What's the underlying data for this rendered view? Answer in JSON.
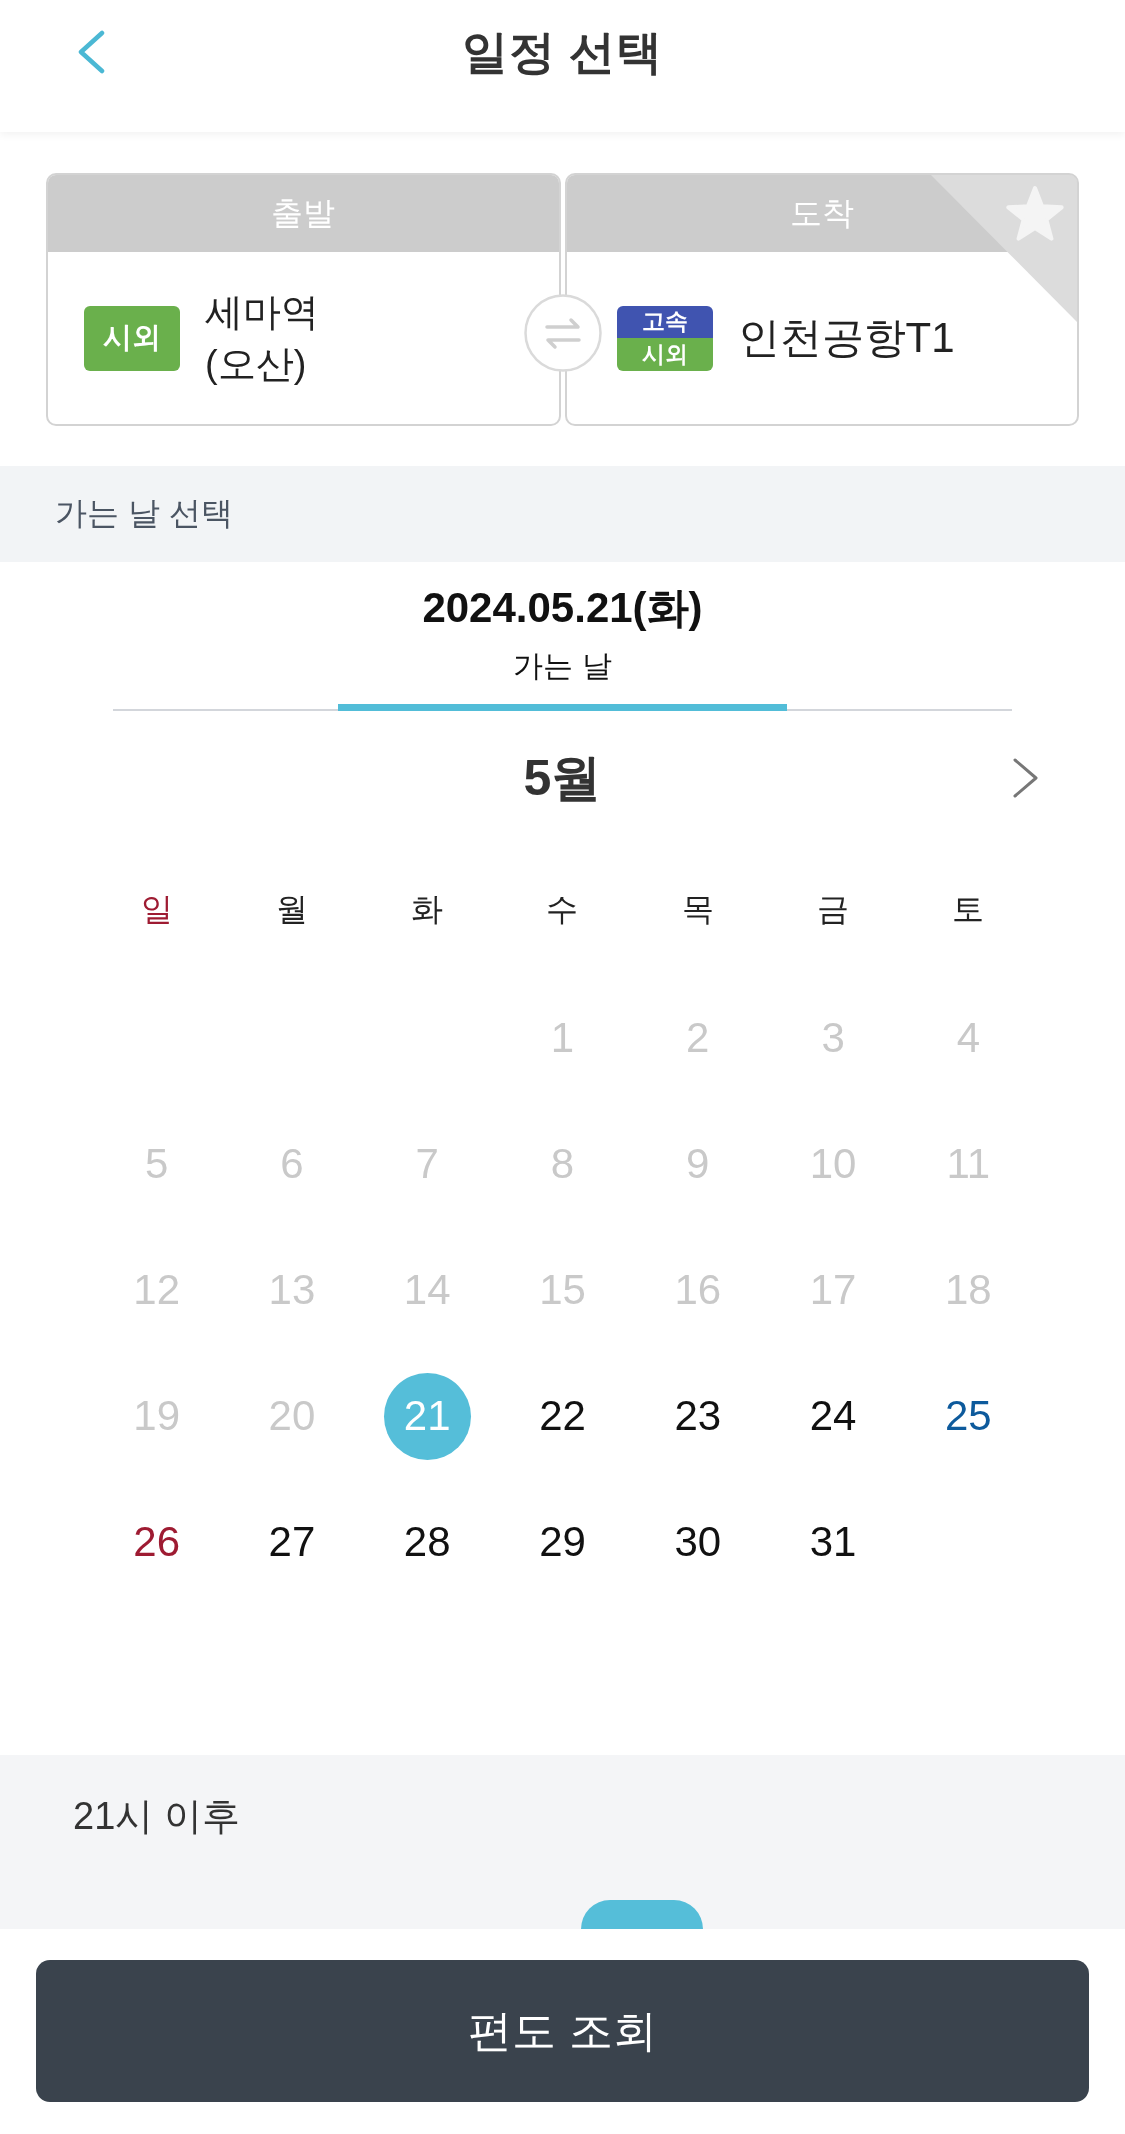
{
  "header": {
    "title": "일정 선택"
  },
  "route": {
    "departure": {
      "label": "출발",
      "badges": [
        {
          "label": "시외",
          "kind": "intercity"
        }
      ],
      "name": "세마역 (오산)"
    },
    "arrival": {
      "label": "도착",
      "badges": [
        {
          "label": "고속",
          "kind": "express"
        },
        {
          "label": "시외",
          "kind": "intercity"
        }
      ],
      "name": "인천공항T1",
      "favorite": false
    }
  },
  "section_title": "가는 날 선택",
  "tabs": [
    {
      "date": "2024.05.21(화)",
      "label": "가는 날",
      "selected": true
    }
  ],
  "calendar": {
    "month": "5월",
    "weekdays": [
      "일",
      "월",
      "화",
      "수",
      "목",
      "금",
      "토"
    ],
    "weeks": [
      [
        {
          "day": "1",
          "disabled": true,
          "selected": false
        },
        {
          "day": "2",
          "disabled": true,
          "selected": false
        },
        {
          "day": "3",
          "disabled": true,
          "selected": false
        },
        {
          "day": "4",
          "disabled": true,
          "selected": false
        }
      ],
      [
        {
          "day": "5",
          "disabled": true,
          "selected": false
        },
        {
          "day": "6",
          "disabled": true,
          "selected": false
        },
        {
          "day": "7",
          "disabled": true,
          "selected": false
        },
        {
          "day": "8",
          "disabled": true,
          "selected": false
        },
        {
          "day": "9",
          "disabled": true,
          "selected": false
        },
        {
          "day": "10",
          "disabled": true,
          "selected": false
        },
        {
          "day": "11",
          "disabled": true,
          "selected": false
        }
      ],
      [
        {
          "day": "12",
          "disabled": true,
          "selected": false
        },
        {
          "day": "13",
          "disabled": true,
          "selected": false
        },
        {
          "day": "14",
          "disabled": true,
          "selected": false
        },
        {
          "day": "15",
          "disabled": true,
          "selected": false
        },
        {
          "day": "16",
          "disabled": true,
          "selected": false
        },
        {
          "day": "17",
          "disabled": true,
          "selected": false
        },
        {
          "day": "18",
          "disabled": true,
          "selected": false
        }
      ],
      [
        {
          "day": "19",
          "disabled": true,
          "selected": false
        },
        {
          "day": "20",
          "disabled": true,
          "selected": false
        },
        {
          "day": "21",
          "disabled": false,
          "selected": true
        },
        {
          "day": "22",
          "disabled": false,
          "selected": false
        },
        {
          "day": "23",
          "disabled": false,
          "selected": false
        },
        {
          "day": "24",
          "disabled": false,
          "selected": false
        },
        {
          "day": "25",
          "disabled": false,
          "selected": false
        }
      ],
      [
        {
          "day": "26",
          "disabled": false,
          "selected": false
        },
        {
          "day": "27",
          "disabled": false,
          "selected": false
        },
        {
          "day": "28",
          "disabled": false,
          "selected": false
        },
        {
          "day": "29",
          "disabled": false,
          "selected": false
        },
        {
          "day": "30",
          "disabled": false,
          "selected": false
        },
        {
          "day": "31",
          "disabled": false,
          "selected": false
        }
      ]
    ]
  },
  "time_section": {
    "title": "21시 이후"
  },
  "footer": {
    "button": "편도 조회"
  }
}
